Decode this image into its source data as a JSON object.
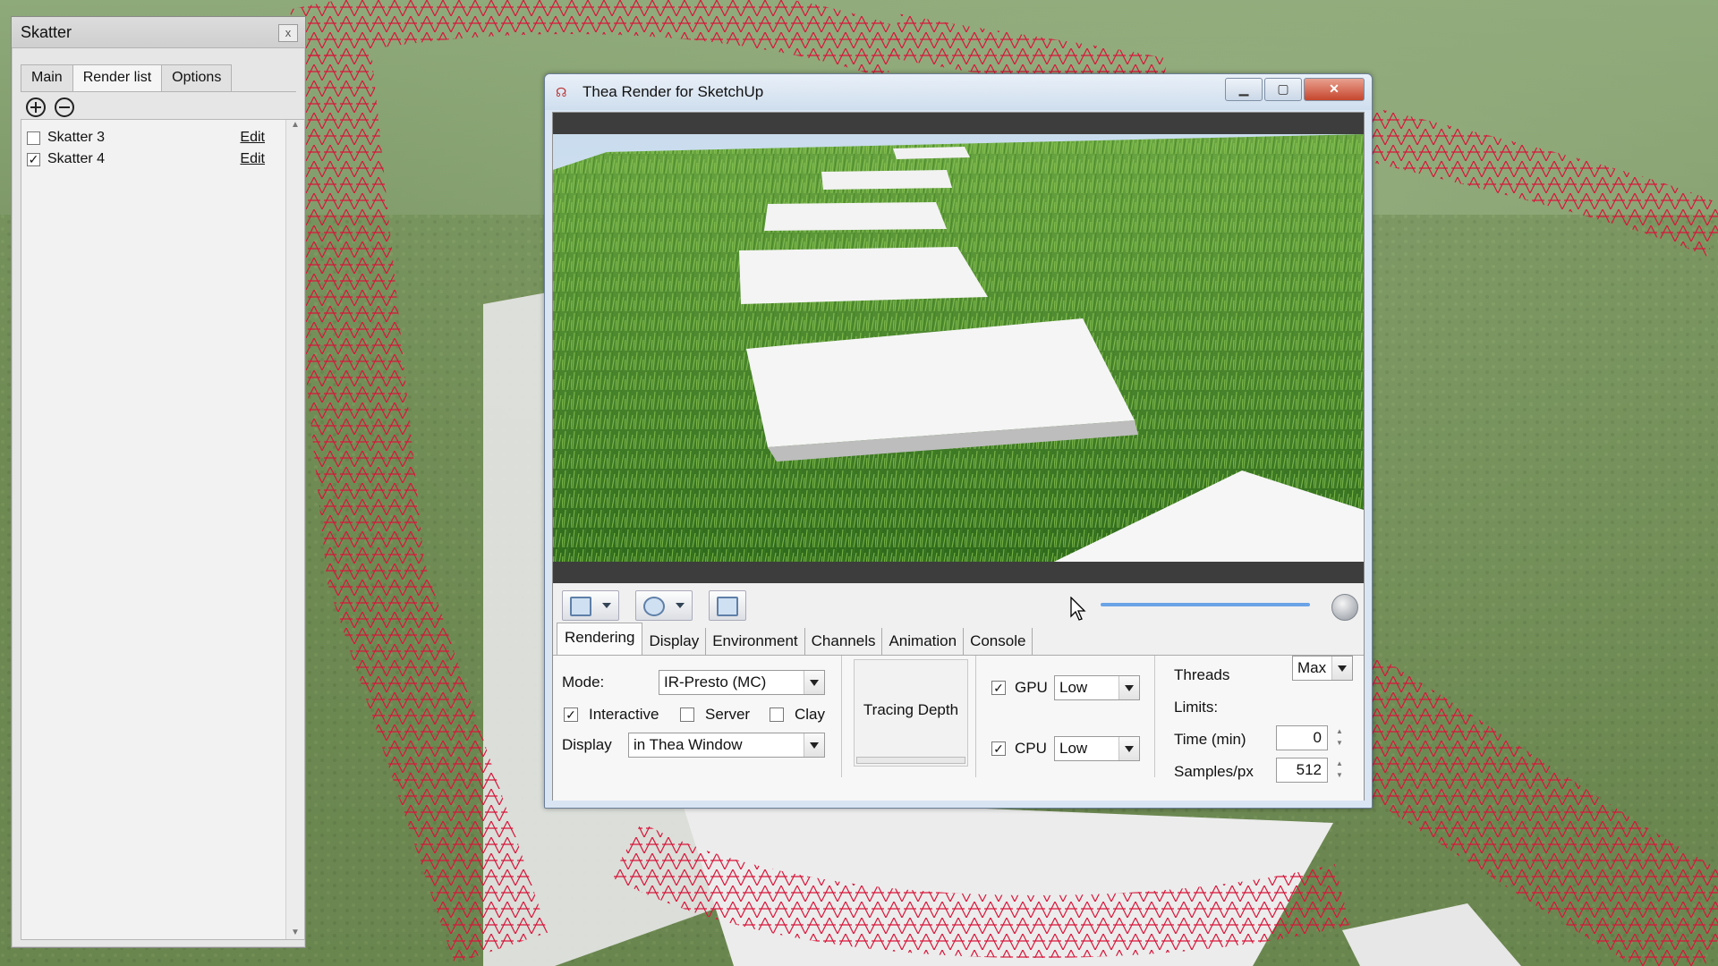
{
  "skatter": {
    "title": "Skatter",
    "close_label": "x",
    "tabs": [
      "Main",
      "Render list",
      "Options"
    ],
    "active_tab": "Render list",
    "items": [
      {
        "name": "Skatter 3",
        "checked": false,
        "edit_label": "Edit"
      },
      {
        "name": "Skatter 4",
        "checked": true,
        "edit_label": "Edit"
      }
    ]
  },
  "thea": {
    "title": "Thea Render for SketchUp",
    "progress": 1.0,
    "tabs": [
      "Rendering",
      "Display",
      "Environment",
      "Channels",
      "Animation",
      "Console"
    ],
    "active_tab": "Rendering",
    "settings": {
      "mode_label": "Mode:",
      "mode_value": "IR-Presto (MC)",
      "interactive_label": "Interactive",
      "interactive_checked": true,
      "server_label": "Server",
      "server_checked": false,
      "clay_label": "Clay",
      "clay_checked": false,
      "display_label": "Display",
      "display_value": "in Thea Window",
      "tracing_depth_label": "Tracing Depth",
      "gpu_label": "GPU",
      "gpu_checked": true,
      "gpu_value": "Low",
      "cpu_label": "CPU",
      "cpu_checked": true,
      "cpu_value": "Low",
      "threads_label": "Threads",
      "threads_value": "Max",
      "limits_label": "Limits:",
      "time_label": "Time (min)",
      "time_value": "0",
      "samples_label": "Samples/px",
      "samples_value": "512"
    }
  },
  "colors": {
    "scatter_red": "#d8163a",
    "grass": "#4f8a2a",
    "accent_blue": "#6aa3e6"
  }
}
